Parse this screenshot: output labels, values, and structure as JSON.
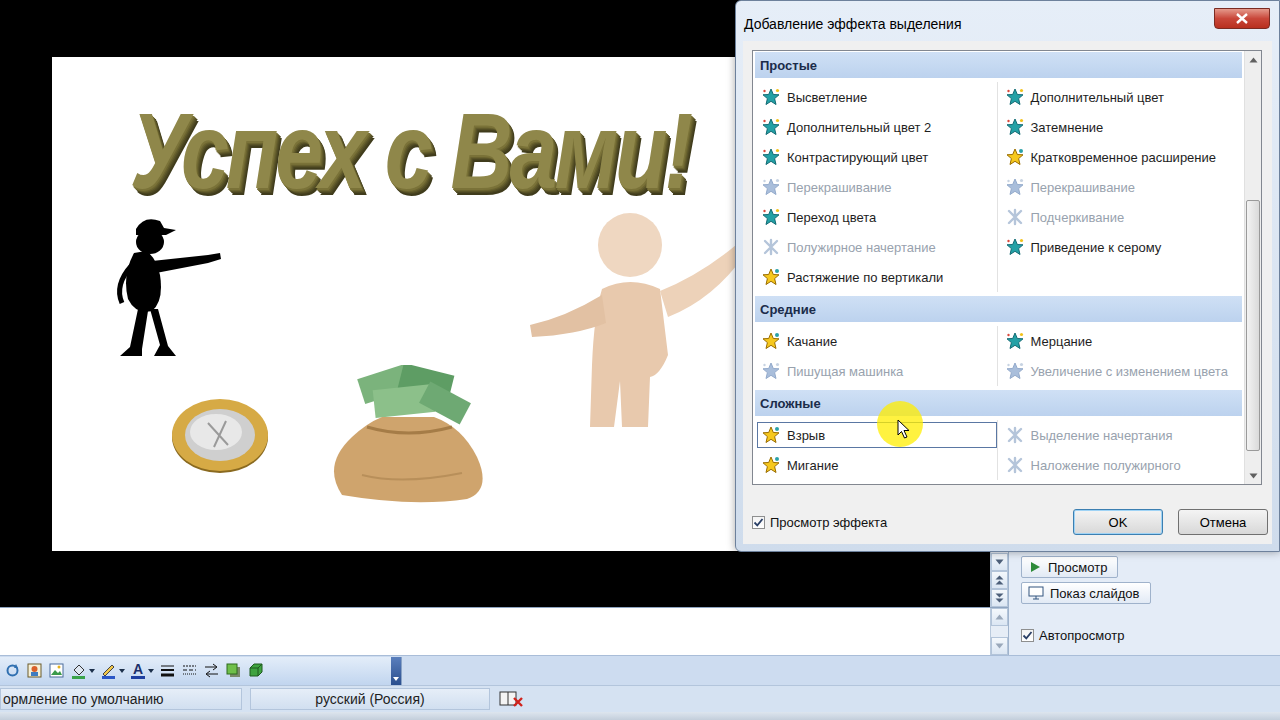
{
  "slide": {
    "title": "Успех с Вами!"
  },
  "dialog": {
    "title": "Добавление эффекта выделения",
    "groups": [
      {
        "label": "Простые",
        "effects": [
          {
            "label": "Высветление",
            "kind": "star",
            "disabled": false,
            "selected": false
          },
          {
            "label": "Дополнительный цвет",
            "kind": "star",
            "disabled": false,
            "selected": false
          },
          {
            "label": "Дополнительный цвет 2",
            "kind": "star",
            "disabled": false,
            "selected": false
          },
          {
            "label": "Затемнение",
            "kind": "star",
            "disabled": false,
            "selected": false
          },
          {
            "label": "Контрастирующий цвет",
            "kind": "star",
            "disabled": false,
            "selected": false
          },
          {
            "label": "Кратковременное расширение",
            "kind": "gold",
            "disabled": false,
            "selected": false
          },
          {
            "label": "Перекрашивание",
            "kind": "star",
            "disabled": true,
            "selected": false
          },
          {
            "label": "Перекрашивание",
            "kind": "star",
            "disabled": true,
            "selected": false
          },
          {
            "label": "Переход цвета",
            "kind": "star",
            "disabled": false,
            "selected": false
          },
          {
            "label": "Подчеркивание",
            "kind": "font",
            "disabled": true,
            "selected": false
          },
          {
            "label": "Полужирное начертание",
            "kind": "font",
            "disabled": true,
            "selected": false
          },
          {
            "label": "Приведение к серому",
            "kind": "star",
            "disabled": false,
            "selected": false
          },
          {
            "label": "Растяжение по вертикали",
            "kind": "gold",
            "disabled": false,
            "selected": false
          }
        ]
      },
      {
        "label": "Средние",
        "effects": [
          {
            "label": "Качание",
            "kind": "gold",
            "disabled": false,
            "selected": false
          },
          {
            "label": "Мерцание",
            "kind": "star",
            "disabled": false,
            "selected": false
          },
          {
            "label": "Пишущая машинка",
            "kind": "star",
            "disabled": true,
            "selected": false
          },
          {
            "label": "Увеличение с изменением цвета",
            "kind": "star",
            "disabled": true,
            "selected": false
          }
        ]
      },
      {
        "label": "Сложные",
        "effects": [
          {
            "label": "Взрыв",
            "kind": "gold",
            "disabled": false,
            "selected": true
          },
          {
            "label": "Выделение начертания",
            "kind": "font",
            "disabled": true,
            "selected": false
          },
          {
            "label": "Мигание",
            "kind": "gold",
            "disabled": false,
            "selected": false
          },
          {
            "label": "Наложение полужирного",
            "kind": "font",
            "disabled": true,
            "selected": false
          }
        ]
      }
    ],
    "scroll": {
      "offset": 0.33,
      "size": 0.63
    },
    "preview": {
      "label": "Просмотр эффекта",
      "checked": true
    },
    "buttons": [
      {
        "label": "OK",
        "default": true
      },
      {
        "label": "Отмена",
        "default": false
      }
    ]
  },
  "task_pane": {
    "buttons": [
      "Просмотр",
      "Показ слайдов"
    ],
    "autopreview": {
      "label": "Автопросмотр",
      "checked": true
    }
  },
  "toolbar": {
    "font_color_glyph": "A"
  },
  "status_bar": {
    "items": [
      "ормление по умолчанию",
      "русский (Россия)"
    ]
  }
}
